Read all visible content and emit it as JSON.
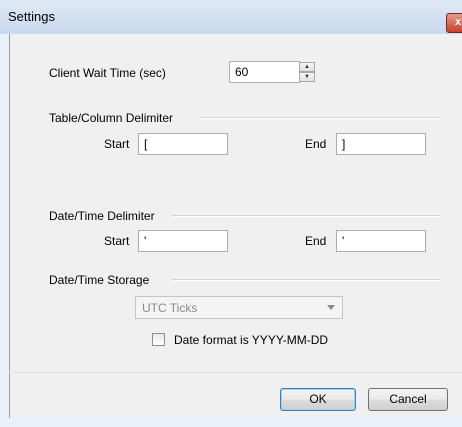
{
  "window": {
    "title": "Settings",
    "close_label": "x"
  },
  "client_wait": {
    "label": "Client Wait Time (sec)",
    "value": "60"
  },
  "table_column_delimiter": {
    "group_label": "Table/Column Delimiter",
    "start_label": "Start",
    "start_value": "[",
    "end_label": "End",
    "end_value": "]"
  },
  "date_time_delimiter": {
    "group_label": "Date/Time Delimiter",
    "start_label": "Start",
    "start_value": "'",
    "end_label": "End",
    "end_value": "'"
  },
  "date_time_storage": {
    "group_label": "Date/Time Storage",
    "selected": "UTC Ticks",
    "checkbox_label": "Date format is YYYY-MM-DD",
    "checkbox_checked": false
  },
  "buttons": {
    "ok_label": "OK",
    "cancel_label": "Cancel"
  }
}
